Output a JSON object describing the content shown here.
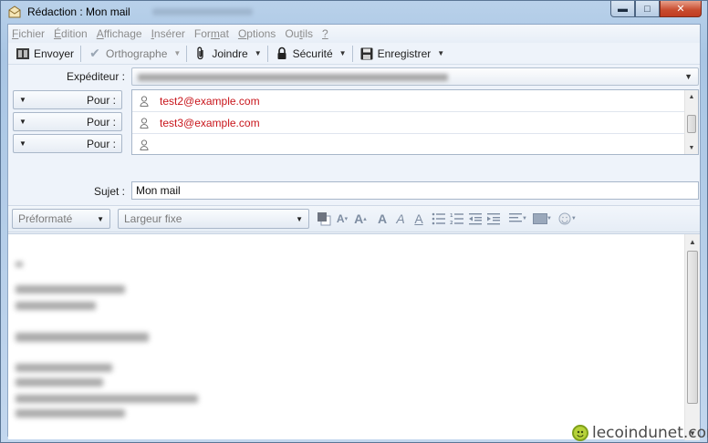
{
  "window": {
    "title": "Rédaction : Mon mail",
    "controls": {
      "minimize": "▬",
      "maximize": "□",
      "close": "✕"
    }
  },
  "menu": [
    {
      "label": "Fichier",
      "accel": "F",
      "rest": "ichier"
    },
    {
      "label": "Édition",
      "accel": "É",
      "rest": "dition"
    },
    {
      "label": "Affichage",
      "accel": "A",
      "rest": "ffichage"
    },
    {
      "label": "Insérer",
      "accel": "I",
      "rest": "nsérer"
    },
    {
      "label": "Format",
      "pre": "For",
      "accel": "m",
      "rest": "at"
    },
    {
      "label": "Options",
      "accel": "O",
      "rest": "ptions"
    },
    {
      "label": "Outils",
      "pre": "Ou",
      "accel": "t",
      "rest": "ils"
    },
    {
      "label": "?",
      "accel": "?",
      "rest": ""
    }
  ],
  "toolbar": {
    "send": "Envoyer",
    "spelling": "Orthographe",
    "attach": "Joindre",
    "security": "Sécurité",
    "save": "Enregistrer"
  },
  "compose": {
    "sender_label": "Expéditeur :",
    "recipients": [
      {
        "type": "Pour :",
        "address": "test2@example.com"
      },
      {
        "type": "Pour :",
        "address": "test3@example.com"
      },
      {
        "type": "Pour :",
        "address": ""
      }
    ],
    "subject_label": "Sujet :",
    "subject_value": "Mon mail"
  },
  "format_bar": {
    "paragraph_format": "Préformaté",
    "font": "Largeur fixe"
  },
  "watermark": "lecoindunet.com",
  "colors": {
    "recipient_text": "#c8151b",
    "window_frame": "#a9c6e4",
    "close_button": "#c74a2d"
  }
}
